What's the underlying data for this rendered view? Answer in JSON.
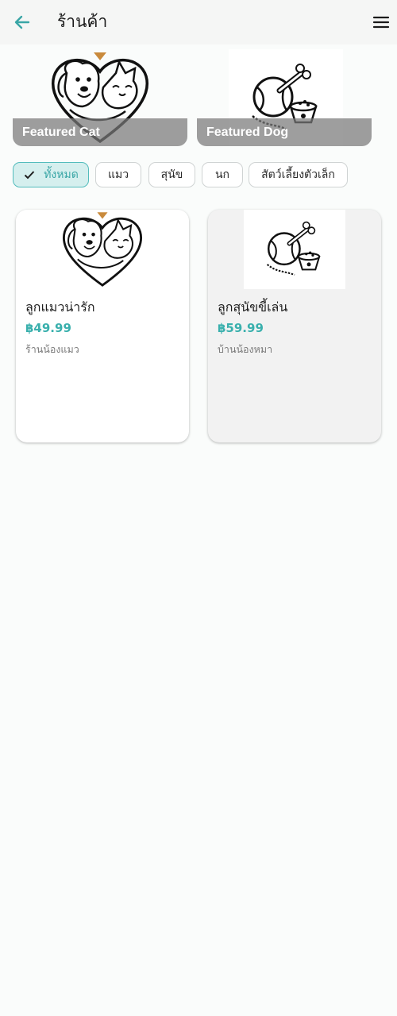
{
  "appbar": {
    "title": "ร้านค้า",
    "back_icon": "arrow-left-icon",
    "menu_icon": "hamburger-menu-icon",
    "accent": "#3aa6a6"
  },
  "featured": [
    {
      "label": "Featured Cat",
      "image": "dog-cat-heart-illustration"
    },
    {
      "label": "Featured Dog",
      "image": "ball-bone-bowl-illustration"
    }
  ],
  "filters": {
    "selected": "ทั้งหมด",
    "items": [
      "ทั้งหมด",
      "แมว",
      "สุนัข",
      "นก",
      "สัตว์เลี้ยงตัวเล็ก"
    ]
  },
  "products": [
    {
      "name": "ลูกแมวน่ารัก",
      "price": "฿49.99",
      "shop": "ร้านน้องแมว",
      "image": "dog-cat-heart-illustration"
    },
    {
      "name": "ลูกสุนัขขี้เล่น",
      "price": "฿59.99",
      "shop": "บ้านน้องหมา",
      "image": "ball-bone-bowl-illustration"
    }
  ],
  "colors": {
    "accent": "#3aa6a6",
    "chip_selected_bg": "#d5efee",
    "price": "#3ab0ad"
  }
}
